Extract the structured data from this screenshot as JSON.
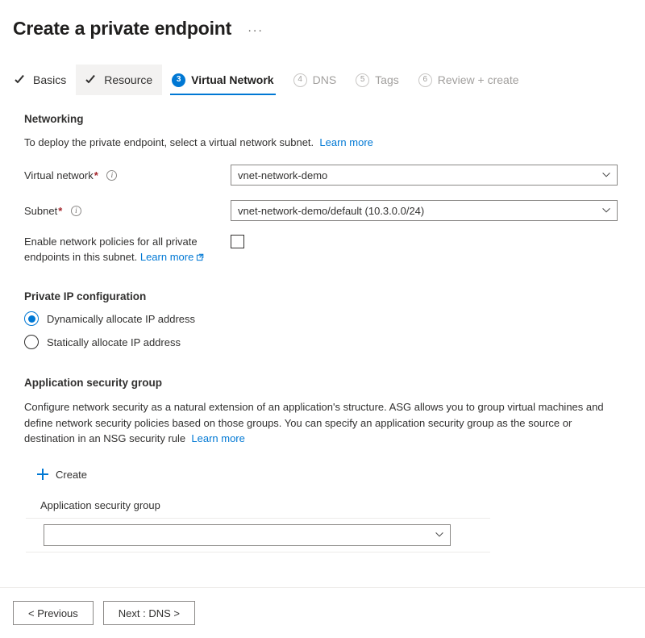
{
  "header": {
    "title": "Create a private endpoint",
    "more_menu": "···"
  },
  "tabs": [
    {
      "label": "Basics",
      "state": "completed",
      "marker": "check"
    },
    {
      "label": "Resource",
      "state": "completed-hover",
      "marker": "check"
    },
    {
      "label": "Virtual Network",
      "state": "active",
      "marker": "3"
    },
    {
      "label": "DNS",
      "state": "disabled",
      "marker": "4"
    },
    {
      "label": "Tags",
      "state": "disabled",
      "marker": "5"
    },
    {
      "label": "Review + create",
      "state": "disabled",
      "marker": "6"
    }
  ],
  "networking": {
    "heading": "Networking",
    "description": "To deploy the private endpoint, select a virtual network subnet.",
    "learn_more": "Learn more",
    "virtual_network": {
      "label": "Virtual network",
      "required_marker": "*",
      "value": "vnet-network-demo",
      "placeholder": ""
    },
    "subnet": {
      "label": "Subnet",
      "required_marker": "*",
      "value": "vnet-network-demo/default (10.3.0.0/24)",
      "placeholder": ""
    },
    "network_policies": {
      "label_line1": "Enable network policies for all private",
      "label_line2": "endpoints in this subnet.",
      "learn_more": "Learn more",
      "checked": false
    }
  },
  "private_ip": {
    "heading": "Private IP configuration",
    "options": [
      {
        "label": "Dynamically allocate IP address",
        "selected": true
      },
      {
        "label": "Statically allocate IP address",
        "selected": false
      }
    ]
  },
  "asg": {
    "heading": "Application security group",
    "description": "Configure network security as a natural extension of an application's structure. ASG allows you to group virtual machines and define network security policies based on those groups. You can specify an application security group as the source or destination in an NSG security rule",
    "learn_more": "Learn more",
    "create_label": "Create",
    "field_label": "Application security group",
    "field_value": "",
    "field_placeholder": ""
  },
  "footer": {
    "previous_label": "< Previous",
    "next_label": "Next : DNS >"
  },
  "colors": {
    "accent": "#0078d4",
    "required": "#a4262c",
    "text": "#323130",
    "muted": "#a19f9d",
    "border": "#8a8886",
    "divider": "#edebe9"
  }
}
